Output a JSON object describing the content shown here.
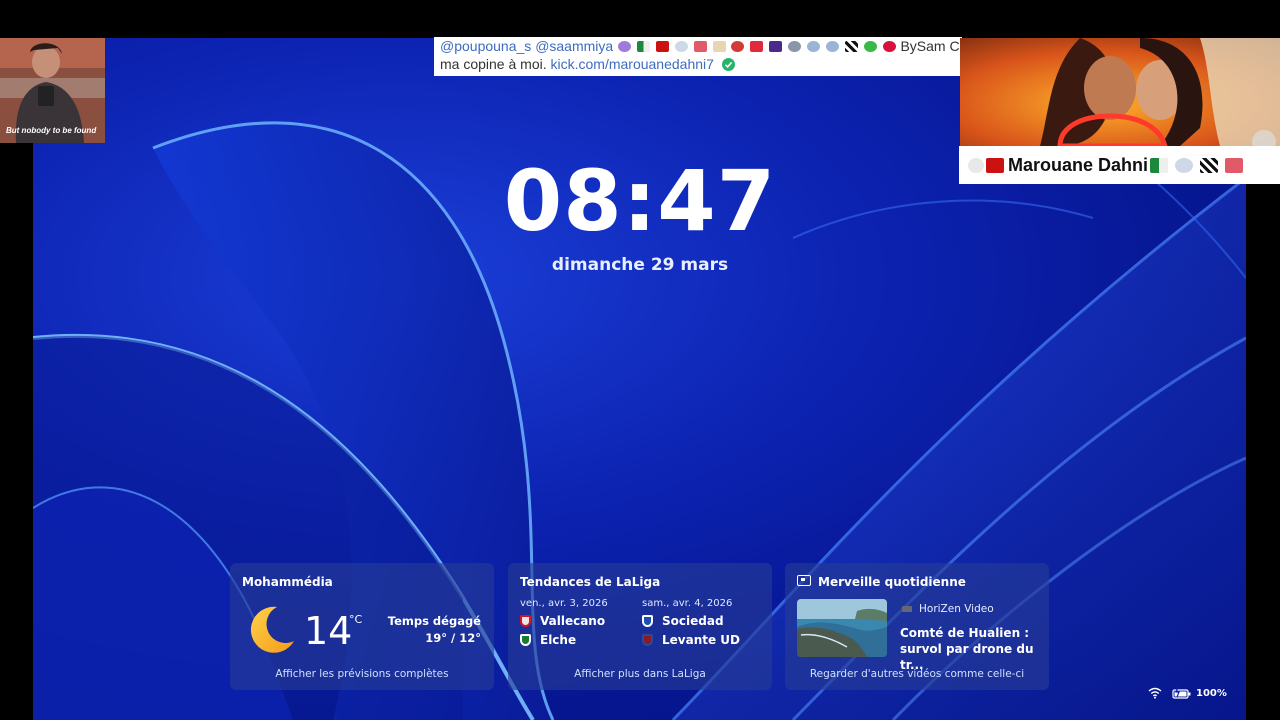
{
  "lockscreen": {
    "time": "08:47",
    "date": "dimanche 29 mars"
  },
  "widgets": {
    "weather": {
      "city": "Mohammédia",
      "icon": "moon-icon",
      "temperature": "14",
      "unit": "°C",
      "condition": "Temps dégagé",
      "hi_lo": "19° / 12°",
      "link": "Afficher les prévisions complètes"
    },
    "laliga": {
      "title": "Tendances de LaLiga",
      "matches": [
        {
          "day": "ven., avr. 3, 2026",
          "home": "Vallecano",
          "away": "Elche"
        },
        {
          "day": "sam., avr. 4, 2026",
          "home": "Sociedad",
          "away": "Levante UD"
        }
      ],
      "link": "Afficher plus dans LaLiga"
    },
    "merveille": {
      "title": "Merveille quotidienne",
      "icon": "video-icon",
      "provider": "HoriZen Video",
      "headline": "Comté de Hualien : survol par drone du tr...",
      "link": "Regarder d'autres vidéos comme celle-ci"
    }
  },
  "tray": {
    "wifi_icon": "wifi-icon",
    "battery_icon": "battery-icon",
    "battery": "100%"
  },
  "overlays": {
    "webcam_caption": "But nobody to be found",
    "chat": {
      "mention1": "@poupouna_s",
      "mention2": "@saammiya",
      "suffix": "BySam C",
      "message": "ma copine à moi.",
      "link": "kick.com/marouanedahni7"
    },
    "streamer_name": "Marouane Dahni"
  },
  "colors": {
    "wallpaper": "#0c22b0",
    "widget_bg": "#263c96",
    "link": "#3d6cc0",
    "verified": "#27b46a"
  }
}
